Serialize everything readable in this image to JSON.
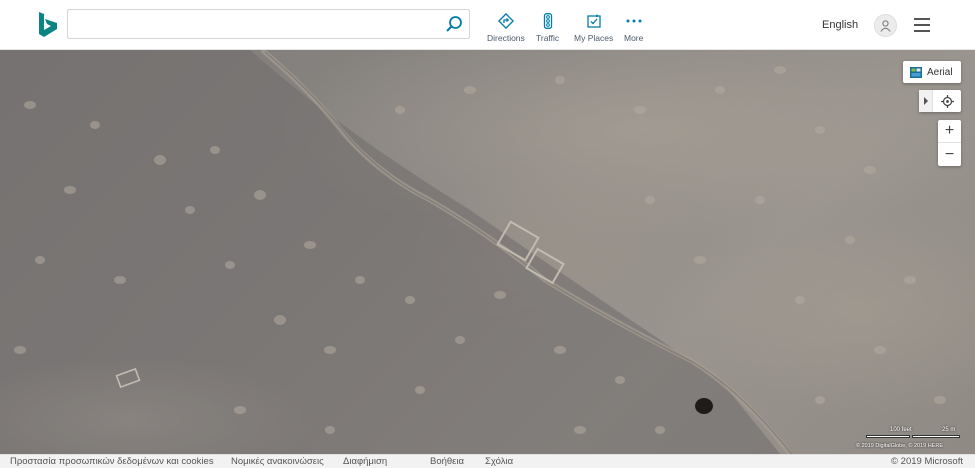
{
  "header": {
    "logo_icon": "bing-logo-icon",
    "search": {
      "value": "",
      "placeholder": "",
      "button_icon": "search-icon"
    },
    "nav": [
      {
        "label": "Directions",
        "icon": "directions-icon"
      },
      {
        "label": "Traffic",
        "icon": "traffic-light-icon"
      },
      {
        "label": "My Places",
        "icon": "my-places-icon"
      },
      {
        "label": "More",
        "icon": "more-dots-icon"
      }
    ],
    "language": "English",
    "avatar_icon": "user-icon",
    "menu_icon": "hamburger-menu-icon",
    "accent_color": "#007daa"
  },
  "map": {
    "style_button": {
      "label": "Aerial",
      "icon": "aerial-map-icon"
    },
    "expand_icon": "chevron-right-icon",
    "locate_icon": "locate-me-icon",
    "zoom_in_label": "+",
    "zoom_out_label": "−",
    "scale": {
      "feet_label": "100 feet",
      "meters_label": "25 m"
    },
    "attribution": "© 2019 DigitalGlobe, © 2019 HERE"
  },
  "footer": {
    "privacy": "Προστασία προσωπικών δεδομένων και cookies",
    "legal": "Νομικές ανακοινώσεις",
    "ads": "Διαφήμιση",
    "help": "Βοήθεια",
    "feedback": "Σχόλια",
    "copyright": "© 2019 Microsoft"
  }
}
